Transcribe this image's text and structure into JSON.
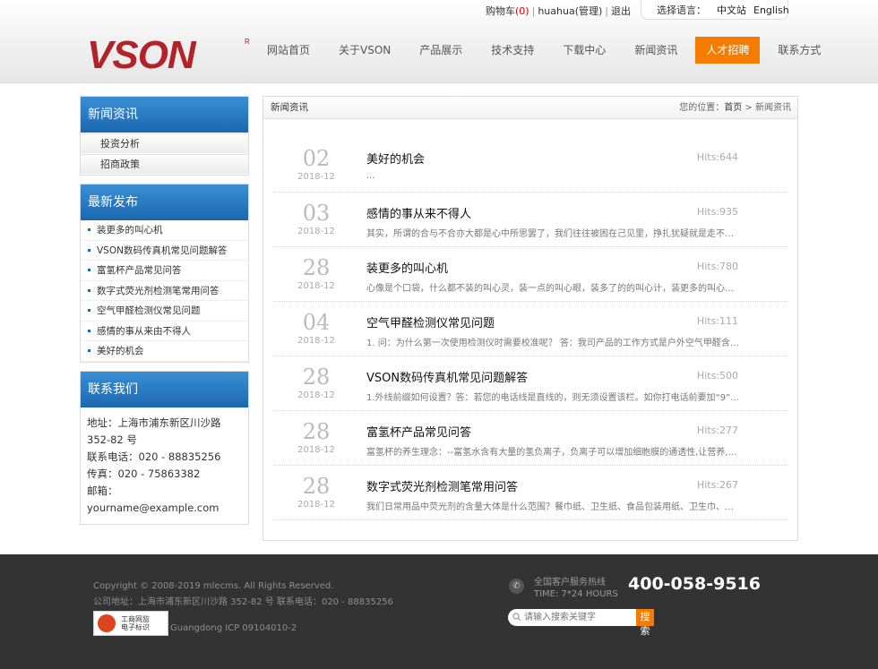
{
  "header": {
    "cart_label": "购物车",
    "cart_count": "(0)",
    "user": "huahua(管理)",
    "logout": "退出",
    "lang_label": "选择语言：",
    "lang_cn": "中文站",
    "lang_en": "English",
    "logo_text": "VSON",
    "nav": [
      "网站首页",
      "关于VSON",
      "产品展示",
      "技术支持",
      "下载中心",
      "新闻资讯",
      "人才招聘",
      "联系方式"
    ],
    "nav_active_index": 6,
    "accent_color": "#f57c00",
    "brand_color": "#b22328"
  },
  "sidebar": {
    "news_title": "新闻资讯",
    "news_items": [
      "投资分析",
      "招商政策"
    ],
    "recent_title": "最新发布",
    "recent_items": [
      "装更多的叫心机",
      "VSON数码传真机常见问题解答",
      "富氢杯产品常见问答",
      "数字式荧光剂检测笔常用问答",
      "空气甲醛检测仪常见问题",
      "感情的事从来由不得人",
      "美好的机会"
    ],
    "contact_title": "联系我们",
    "contact_address": "地址：上海市浦东新区川沙路 352-82 号",
    "contact_phone": "联系电话：020 - 88835256",
    "contact_fax": "传真：020 - 75863382",
    "contact_email": "邮箱：yourname@example.com"
  },
  "main": {
    "title": "新闻资讯",
    "crumb_prefix": "您的位置：",
    "crumb_home": "首页",
    "crumb_sep": ">",
    "crumb_current": "新闻资讯",
    "news": [
      {
        "day": "02",
        "ym": "2018-12",
        "title": "美好的机会",
        "desc": "...",
        "hits": "Hits:644"
      },
      {
        "day": "03",
        "ym": "2018-12",
        "title": "感情的事从来不得人",
        "desc": "其实，所谓的合与不合亦大都是心中所思罢了，我们往往被困在己见里，挣扎犹疑就是走不出来...",
        "hits": "Hits:935"
      },
      {
        "day": "28",
        "ym": "2018-12",
        "title": "装更多的叫心机",
        "desc": "心像是个口袋，什么都不装的叫心灵，装一点的叫心眼，装多了的的叫心计，装更多的叫心机，...",
        "hits": "Hits:780"
      },
      {
        "day": "04",
        "ym": "2018-12",
        "title": "空气甲醛检测仪常见问题",
        "desc": "1. 问：为什么第一次使用检测仪时需要校准呢？ 答：我司产品的工作方式是户外空气甲醛含量...",
        "hits": "Hits:111"
      },
      {
        "day": "28",
        "ym": "2018-12",
        "title": "VSON数码传真机常见问题解答",
        "desc": "1.外线前缀如何设置？答：若您的电话线是直线的，则无须设置该栏。如你打电话前要加“9”...",
        "hits": "Hits:500"
      },
      {
        "day": "28",
        "ym": "2018-12",
        "title": "富氢杯产品常见问答",
        "desc": "富氢杯的养生理念：--富氢水含有大量的氢负离子，负离子可以增加细胞膜的通透性,让营养,水...",
        "hits": "Hits:277"
      },
      {
        "day": "28",
        "ym": "2018-12",
        "title": "数字式荧光剂检测笔常用问答",
        "desc": "我们日常用品中荧光剂的含量大体是什么范围？餐巾纸、卫生纸、食品包装用纸、卫生巾、尿不...",
        "hits": "Hits:267"
      }
    ]
  },
  "footer": {
    "copyright": "Copyright © 2008-2019 mlecms. All Rights Reserved.",
    "address": "公司地址：上海市浦东新区川沙路 352-82 号 联系电话：020 - 88835256",
    "badge_line1": "工商网监",
    "badge_line2": "电子标识",
    "icp": "Guangdong ICP 09104010-2",
    "hotline_label": "全国客户服务热线",
    "hotline_hours": "TIME: 7*24 HOURS",
    "hotline": "400-058-9516",
    "search_placeholder": "请输入搜索关键字",
    "search_button": "搜 索"
  }
}
